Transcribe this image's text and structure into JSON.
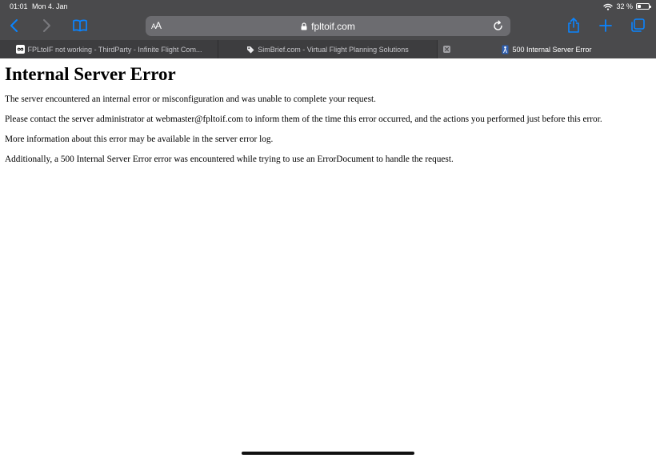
{
  "status_bar": {
    "time": "01:01",
    "date": "Mon 4. Jan",
    "battery": "32 %",
    "battery_level": 0.32,
    "icons": [
      "wifi-icon",
      "battery-icon"
    ]
  },
  "toolbar": {
    "icons": [
      "back-icon",
      "forward-icon",
      "bookmarks-icon",
      "share-icon",
      "new-tab-icon",
      "tabs-overview-icon"
    ],
    "reader_label_small": "A",
    "reader_label_large": "A",
    "url": "fpltoif.com",
    "accent_color": "#0a84ff"
  },
  "tabs": [
    {
      "title": "FPLtoIF not working - ThirdParty - Infinite Flight Com...",
      "icon": "infinite-flight-icon"
    },
    {
      "title": "SimBrief.com - Virtual Flight Planning Solutions",
      "icon": "tag-icon"
    },
    {
      "title": "500 Internal Server Error",
      "icon": "bookmark-figure-icon",
      "active": true
    }
  ],
  "page": {
    "heading": "Internal Server Error",
    "paragraphs": [
      "The server encountered an internal error or misconfiguration and was unable to complete your request.",
      "Please contact the server administrator at webmaster@fpltoif.com to inform them of the time this error occurred, and the actions you performed just before this error.",
      "More information about this error may be available in the server error log.",
      "Additionally, a 500 Internal Server Error error was encountered while trying to use an ErrorDocument to handle the request."
    ]
  }
}
